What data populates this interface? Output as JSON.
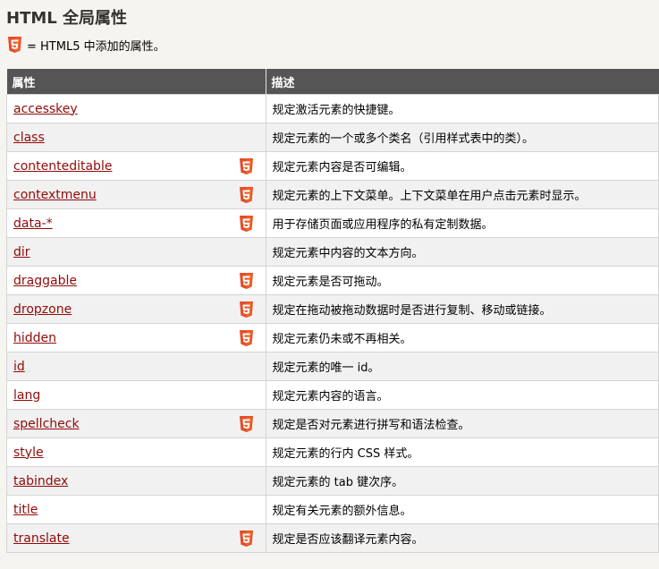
{
  "page": {
    "title": "HTML 全局属性",
    "legend_text": "= HTML5 中添加的属性。"
  },
  "table": {
    "headers": [
      "属性",
      "描述"
    ],
    "rows": [
      {
        "name": "accesskey",
        "html5": false,
        "desc": "规定激活元素的快捷键。"
      },
      {
        "name": "class",
        "html5": false,
        "desc": "规定元素的一个或多个类名（引用样式表中的类）。"
      },
      {
        "name": "contenteditable",
        "html5": true,
        "desc": "规定元素内容是否可编辑。"
      },
      {
        "name": "contextmenu",
        "html5": true,
        "desc": "规定元素的上下文菜单。上下文菜单在用户点击元素时显示。"
      },
      {
        "name": "data-*",
        "html5": true,
        "desc": "用于存储页面或应用程序的私有定制数据。"
      },
      {
        "name": "dir",
        "html5": false,
        "desc": "规定元素中内容的文本方向。"
      },
      {
        "name": "draggable",
        "html5": true,
        "desc": "规定元素是否可拖动。"
      },
      {
        "name": "dropzone",
        "html5": true,
        "desc": "规定在拖动被拖动数据时是否进行复制、移动或链接。"
      },
      {
        "name": "hidden",
        "html5": true,
        "desc": "规定元素仍未或不再相关。"
      },
      {
        "name": "id",
        "html5": false,
        "desc": "规定元素的唯一 id。"
      },
      {
        "name": "lang",
        "html5": false,
        "desc": "规定元素内容的语言。"
      },
      {
        "name": "spellcheck",
        "html5": true,
        "desc": "规定是否对元素进行拼写和语法检查。"
      },
      {
        "name": "style",
        "html5": false,
        "desc": "规定元素的行内 CSS 样式。"
      },
      {
        "name": "tabindex",
        "html5": false,
        "desc": "规定元素的 tab 键次序。"
      },
      {
        "name": "title",
        "html5": false,
        "desc": "规定有关元素的额外信息。"
      },
      {
        "name": "translate",
        "html5": true,
        "desc": "规定是否应该翻译元素内容。"
      }
    ]
  },
  "icons": {
    "html5_badge": "html5-icon"
  },
  "colors": {
    "link": "#900b09",
    "header_bg": "#555555",
    "html5_orange": "#e44d26",
    "html5_light": "#f16529"
  }
}
